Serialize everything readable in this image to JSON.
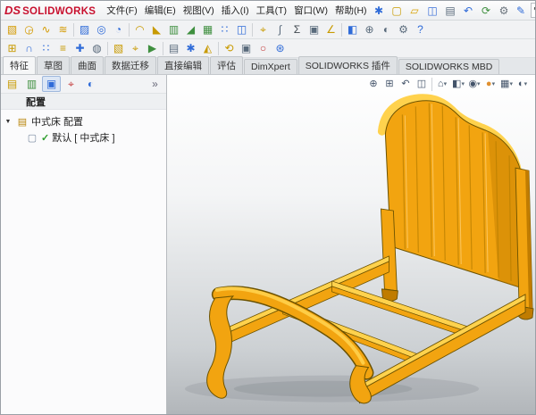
{
  "logo": {
    "ds": "DS",
    "text": "SOLIDWORKS"
  },
  "menubar": {
    "items": [
      {
        "id": "file",
        "label": "文件(F)"
      },
      {
        "id": "edit",
        "label": "编辑(E)"
      },
      {
        "id": "view",
        "label": "视图(V)"
      },
      {
        "id": "insert",
        "label": "插入(I)"
      },
      {
        "id": "tools",
        "label": "工具(T)"
      },
      {
        "id": "window",
        "label": "窗口(W)"
      },
      {
        "id": "help",
        "label": "帮助(H)"
      }
    ]
  },
  "quickbar": {
    "icons": [
      {
        "name": "pin-menu-icon",
        "glyph": "✱",
        "color": "#2f6bd8"
      },
      {
        "name": "new-document-icon",
        "glyph": "▢",
        "color": "#c89a00"
      },
      {
        "name": "open-document-icon",
        "glyph": "▱",
        "color": "#d8a000"
      },
      {
        "name": "save-icon",
        "glyph": "◫",
        "color": "#3a6fd8"
      },
      {
        "name": "print-icon",
        "glyph": "▤",
        "color": "#5a6b7c"
      },
      {
        "name": "undo-icon",
        "glyph": "↶",
        "color": "#2f6bd8"
      },
      {
        "name": "rebuild-icon",
        "glyph": "⟳",
        "color": "#3f8f3f"
      },
      {
        "name": "options-icon",
        "glyph": "⚙",
        "color": "#6a737c"
      }
    ]
  },
  "menubar_right": {
    "icons": [
      {
        "name": "edit-appearance-pencil-icon",
        "glyph": "✎",
        "color": "#2f6bd8"
      }
    ],
    "cursor_glyph": "↖",
    "cursor_caret": "▾"
  },
  "toolbar_row1": {
    "icons": [
      {
        "name": "boss-extrude-icon",
        "glyph": "▧",
        "color": "#d49a00"
      },
      {
        "name": "revolved-boss-icon",
        "glyph": "◶",
        "color": "#d49a00"
      },
      {
        "name": "swept-boss-icon",
        "glyph": "∿",
        "color": "#d49a00"
      },
      {
        "name": "lofted-boss-icon",
        "glyph": "≋",
        "color": "#d49a00"
      },
      {
        "sep": true
      },
      {
        "name": "extruded-cut-icon",
        "glyph": "▨",
        "color": "#2f6bd8"
      },
      {
        "name": "hole-wizard-icon",
        "glyph": "◎",
        "color": "#2f6bd8"
      },
      {
        "name": "revolved-cut-icon",
        "glyph": "◔",
        "color": "#2f6bd8"
      },
      {
        "sep": true
      },
      {
        "name": "fillet-icon",
        "glyph": "◠",
        "color": "#c89a00"
      },
      {
        "name": "chamfer-icon",
        "glyph": "◣",
        "color": "#c89a00"
      },
      {
        "name": "rib-icon",
        "glyph": "▥",
        "color": "#3f8f3f"
      },
      {
        "name": "draft-icon",
        "glyph": "◢",
        "color": "#3f8f3f"
      },
      {
        "name": "shell-icon",
        "glyph": "▦",
        "color": "#3f8f3f"
      },
      {
        "name": "linear-pattern-icon",
        "glyph": "∷",
        "color": "#2f6bd8"
      },
      {
        "name": "mirror-icon",
        "glyph": "◫",
        "color": "#2f6bd8"
      },
      {
        "sep": true
      },
      {
        "name": "reference-geometry-icon",
        "glyph": "⌖",
        "color": "#c89a00"
      },
      {
        "name": "curves-icon",
        "glyph": "∫",
        "color": "#5a6b7c"
      },
      {
        "name": "equations-icon",
        "glyph": "Σ",
        "color": "#40484f"
      },
      {
        "name": "camera-icon",
        "glyph": "▣",
        "color": "#5a6b7c"
      },
      {
        "name": "measure-icon",
        "glyph": "∠",
        "color": "#c89a00"
      },
      {
        "sep": true
      },
      {
        "name": "section-view-icon",
        "glyph": "◧",
        "color": "#2f6bd8"
      },
      {
        "name": "zoom-icon",
        "glyph": "⊕",
        "color": "#5a6b7c"
      },
      {
        "name": "display-style-icon",
        "glyph": "◐",
        "color": "#5a6b7c"
      },
      {
        "name": "settings-icon",
        "glyph": "⚙",
        "color": "#5a6b7c"
      },
      {
        "name": "help-icon",
        "glyph": "?",
        "color": "#2f6bd8"
      }
    ]
  },
  "toolbar_row2": {
    "icons": [
      {
        "name": "insert-component-icon",
        "glyph": "⊞",
        "color": "#c89a00"
      },
      {
        "name": "mate-icon",
        "glyph": "∩",
        "color": "#2f6bd8"
      },
      {
        "name": "component-pattern-icon",
        "glyph": "∷",
        "color": "#2f6bd8"
      },
      {
        "name": "smart-fastener-icon",
        "glyph": "≡",
        "color": "#c89a00"
      },
      {
        "name": "move-component-icon",
        "glyph": "✚",
        "color": "#2f6bd8"
      },
      {
        "name": "show-hidden-icon",
        "glyph": "◍",
        "color": "#5a6b7c"
      },
      {
        "sep": true
      },
      {
        "name": "assembly-feature-icon",
        "glyph": "▧",
        "color": "#c89a00"
      },
      {
        "name": "reference-geo-icon",
        "glyph": "⌖",
        "color": "#c89a00"
      },
      {
        "name": "motion-study-icon",
        "glyph": "▶",
        "color": "#3f8f3f"
      },
      {
        "sep": true
      },
      {
        "name": "bill-of-materials-icon",
        "glyph": "▤",
        "color": "#5a6b7c"
      },
      {
        "name": "exploded-view-icon",
        "glyph": "✱",
        "color": "#2f6bd8"
      },
      {
        "name": "instant3d-icon",
        "glyph": "◭",
        "color": "#c89a00"
      },
      {
        "sep": true
      },
      {
        "name": "update-icon",
        "glyph": "⟲",
        "color": "#c89a00"
      },
      {
        "name": "snapshot-icon",
        "glyph": "▣",
        "color": "#5a6b7c"
      },
      {
        "name": "sketch-circle-icon",
        "glyph": "○",
        "color": "#c43c3c"
      },
      {
        "name": "toolbox-icon",
        "glyph": "⊛",
        "color": "#2f6bd8"
      }
    ]
  },
  "command_tabs": {
    "items": [
      {
        "id": "features",
        "label": "特征",
        "active": true
      },
      {
        "id": "sketch",
        "label": "草图",
        "active": false
      },
      {
        "id": "surfaces",
        "label": "曲面",
        "active": false
      },
      {
        "id": "data-migration",
        "label": "数据迁移",
        "active": false
      },
      {
        "id": "direct-editing",
        "label": "直接编辑",
        "active": false
      },
      {
        "id": "evaluate",
        "label": "评估",
        "active": false
      },
      {
        "id": "dimxpert",
        "label": "DimXpert",
        "active": false
      },
      {
        "id": "sw-addins",
        "label": "SOLIDWORKS 插件",
        "active": false
      },
      {
        "id": "sw-mbd",
        "label": "SOLIDWORKS MBD",
        "active": false
      }
    ]
  },
  "panel": {
    "tabs": [
      {
        "name": "featuremanager-tab-icon",
        "glyph": "▤",
        "color": "#c89a00",
        "active": false
      },
      {
        "name": "propertymanager-tab-icon",
        "glyph": "▥",
        "color": "#3f8f3f",
        "active": false
      },
      {
        "name": "configurationmanager-tab-icon",
        "glyph": "▣",
        "color": "#2f6bd8",
        "active": true
      },
      {
        "name": "dimxpertmanager-tab-icon",
        "glyph": "⌖",
        "color": "#c43c3c",
        "active": false
      },
      {
        "name": "displaymanager-tab-icon",
        "glyph": "◐",
        "color": "#2f6bd8",
        "active": false
      }
    ],
    "overflow_glyph": "»",
    "header": "配置",
    "tree": {
      "root": {
        "caret": "▼",
        "icon_glyph": "▤",
        "label": "中式床 配置"
      },
      "child": {
        "icon_glyph": "▢",
        "check": "✓",
        "label": "默认 [ 中式床 ]"
      }
    }
  },
  "headsup": {
    "icons": [
      {
        "name": "zoom-fit-icon",
        "glyph": "⊕",
        "color": "#44546a",
        "caret": false
      },
      {
        "name": "zoom-area-icon",
        "glyph": "⊞",
        "color": "#44546a",
        "caret": false
      },
      {
        "name": "previous-view-icon",
        "glyph": "↶",
        "color": "#44546a",
        "caret": false
      },
      {
        "name": "section-view-icon",
        "glyph": "◫",
        "color": "#44546a",
        "caret": false
      },
      {
        "sep": true
      },
      {
        "name": "view-orientation-icon",
        "glyph": "⌂",
        "color": "#44546a",
        "caret": true
      },
      {
        "name": "display-style-icon",
        "glyph": "◧",
        "color": "#44546a",
        "caret": true
      },
      {
        "name": "hide-show-items-icon",
        "glyph": "◉",
        "color": "#44546a",
        "caret": true
      },
      {
        "name": "edit-appearance-icon",
        "glyph": "●",
        "color": "#e09030",
        "caret": true
      },
      {
        "name": "apply-scene-icon",
        "glyph": "▦",
        "color": "#44546a",
        "caret": true
      },
      {
        "name": "view-settings-icon",
        "glyph": "◐",
        "color": "#44546a",
        "caret": true
      }
    ]
  },
  "model": {
    "name": "中式床",
    "colors": {
      "main": "#F2A410",
      "light": "#FFD24D",
      "dark": "#C07C00",
      "outline": "#6B5200"
    }
  }
}
